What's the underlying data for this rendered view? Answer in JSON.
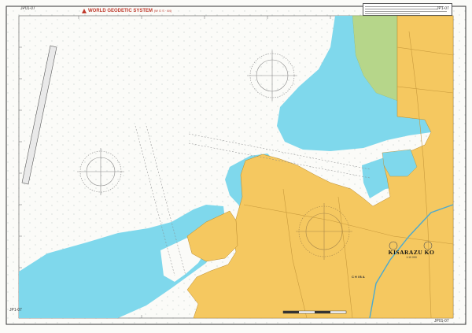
{
  "chart": {
    "title": "KISARAZU KO",
    "datum_banner": "WORLD GEODETIC SYSTEM",
    "datum_suffix": "(W G S · 84)",
    "place_label": "CHIBA",
    "corner_top_left": "JP01-07",
    "corner_top_right": "JP1-07",
    "corner_bottom_left": "JP1-07",
    "corner_bottom_right": "JP01-07",
    "scale_text": "1:10 000"
  },
  "colors": {
    "land": "#f5c860",
    "land_edge": "#b98a2c",
    "shallow_water": "#7fd8ec",
    "deep_water": "#fbfbf8",
    "marsh": "#b6d68a",
    "border": "#333333",
    "datum_text": "#c0392b"
  },
  "icons": [
    "compass-rose-icon",
    "wgs-mark-icon"
  ]
}
